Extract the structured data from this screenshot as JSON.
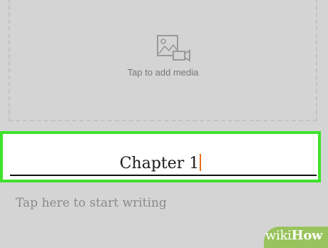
{
  "media": {
    "placeholder": "Tap to add media",
    "icon": "image-video-icon"
  },
  "title_field": {
    "value": "Chapter 1",
    "highlight_color": "#3ee22b",
    "cursor_color": "#e8711e"
  },
  "body_field": {
    "placeholder": "Tap here to start writing"
  },
  "watermark": {
    "part1": "wiki",
    "part2": "How",
    "color": "#99c35c"
  }
}
